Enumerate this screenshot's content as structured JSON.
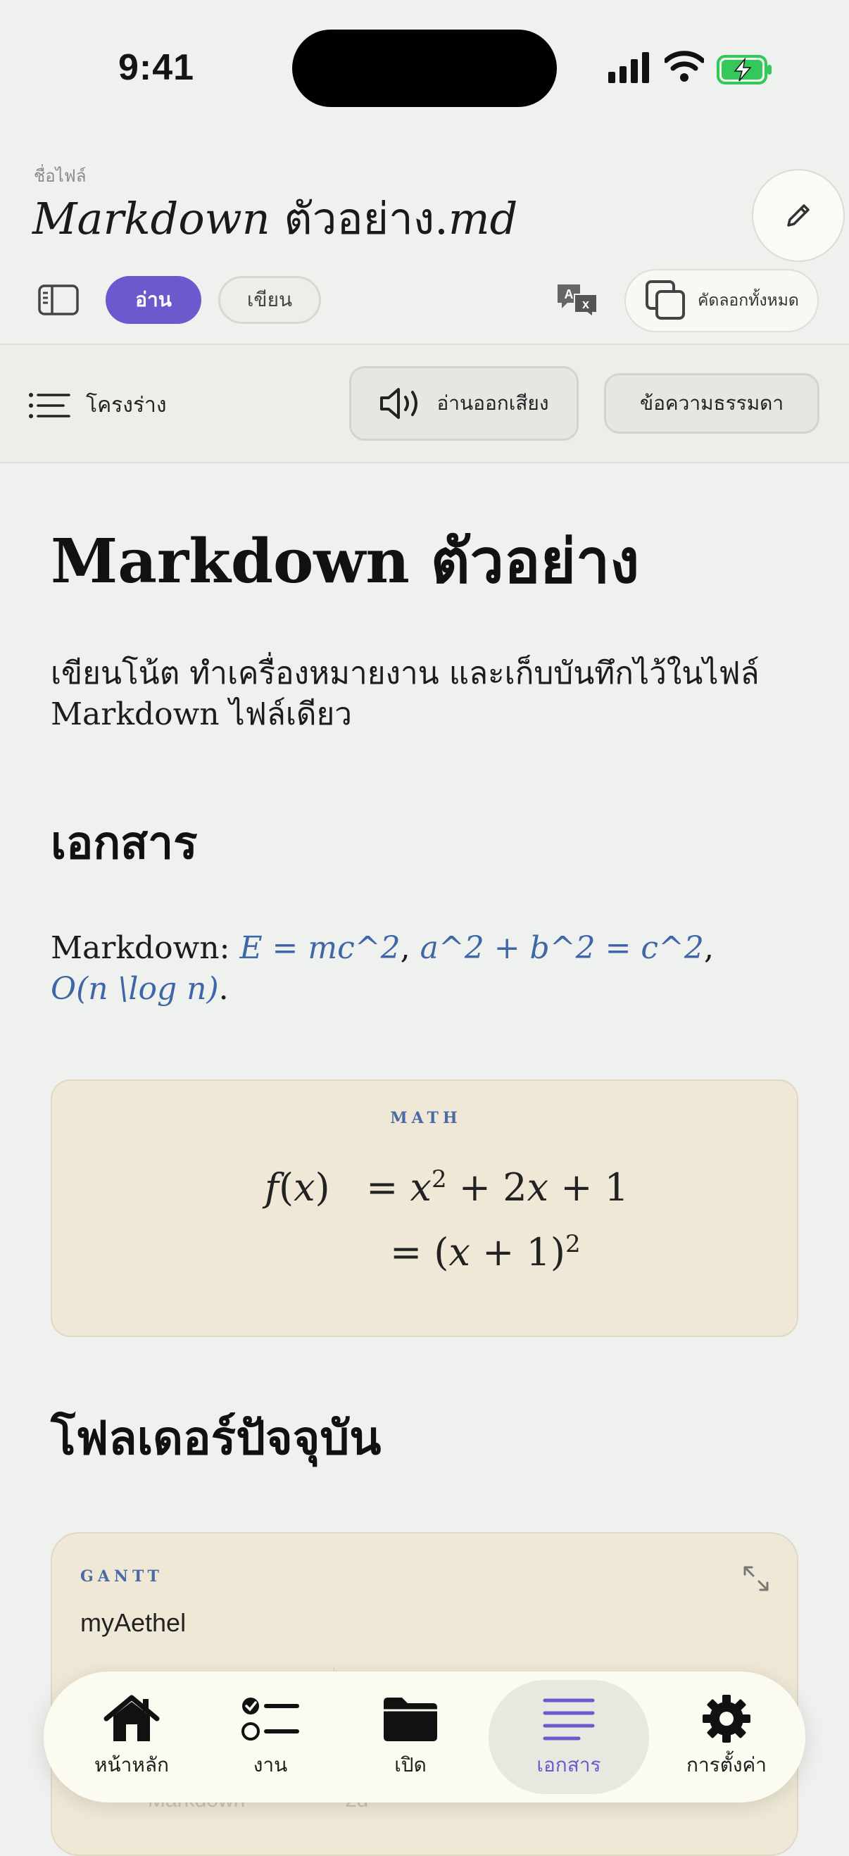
{
  "status": {
    "time": "9:41"
  },
  "header": {
    "file_label": "ชื่อไฟล์",
    "file_title_upright_a": "",
    "file_title_italic_a": "Markdown",
    "file_title_upright_b": " ตัวอย่าง.",
    "file_title_italic_b": "md"
  },
  "toolbar": {
    "read_label": "อ่าน",
    "write_label": "เขียน",
    "copy_all_label": "คัดลอกทั้งหมด"
  },
  "subbar": {
    "outline_label": "โครงร่าง",
    "read_aloud_label": "อ่านออกเสียง",
    "plain_text_label": "ข้อความธรรมดา"
  },
  "document": {
    "h1": "Markdown ตัวอย่าง",
    "p1": "เขียนโน้ต ทำเครื่องหมายงาน และเก็บบันทึกไว้ในไฟล์ Markdown ไฟล์เดียว",
    "h2_documents": "เอกสาร",
    "p2_prefix": "Markdown: ",
    "p2_math1": "E = mc^2",
    "p2_sep1": ", ",
    "p2_math2": "a^2 + b^2 = c^2",
    "p2_sep2": ", ",
    "p2_math3": "O(n \\log n)",
    "p2_end": ".",
    "math_tag": "MATH",
    "h2_folder": "โฟลเดอร์ปัจจุบัน",
    "gantt_tag": "GANTT",
    "gantt_title": "myAethel",
    "gantt_row_label": "Markdown",
    "gantt_row_value": "2d"
  },
  "tabbar": {
    "items": [
      {
        "label": "หน้าหลัก",
        "icon": "house-icon"
      },
      {
        "label": "งาน",
        "icon": "checklist-icon"
      },
      {
        "label": "เปิด",
        "icon": "folder-icon"
      },
      {
        "label": "เอกสาร",
        "icon": "document-lines-icon",
        "selected": true
      },
      {
        "label": "การตั้งค่า",
        "icon": "gear-icon"
      }
    ]
  },
  "colors": {
    "accent": "#6a5acd",
    "math_inline": "#3f66a8",
    "card_bg": "#efe8d6",
    "battery_green": "#34c759"
  }
}
